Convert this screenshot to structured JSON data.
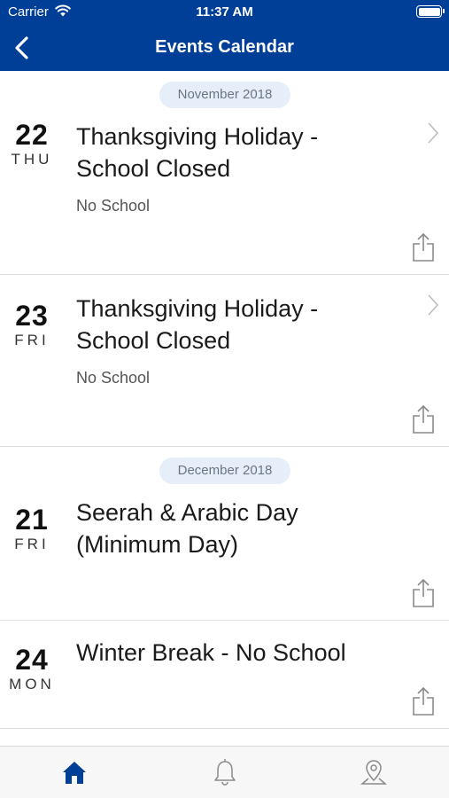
{
  "status_bar": {
    "carrier": "Carrier",
    "time": "11:37 AM"
  },
  "nav": {
    "title": "Events Calendar",
    "back_icon": "chevron-left-icon"
  },
  "months": [
    {
      "label": "November 2018"
    },
    {
      "label": "December 2018"
    }
  ],
  "events": [
    {
      "day": "22",
      "weekday": "THU",
      "title_line1": "Thanksgiving Holiday -",
      "title_line2": "School Closed",
      "subtitle": "No School",
      "has_detail": true
    },
    {
      "day": "23",
      "weekday": "FRI",
      "title_line1": "Thanksgiving Holiday -",
      "title_line2": "School Closed",
      "subtitle": "No School",
      "has_detail": true
    },
    {
      "day": "21",
      "weekday": "FRI",
      "title_line1": "Seerah & Arabic Day",
      "title_line2": "(Minimum Day)",
      "subtitle": "",
      "has_detail": false
    },
    {
      "day": "24",
      "weekday": "MON",
      "title_line1": "Winter Break - No School",
      "title_line2": "",
      "subtitle": "",
      "has_detail": false
    }
  ],
  "tab_bar": {
    "tabs": [
      {
        "icon": "home-icon",
        "active": true
      },
      {
        "icon": "bell-icon",
        "active": false
      },
      {
        "icon": "map-pin-icon",
        "active": false
      }
    ]
  },
  "colors": {
    "brand": "#003f98",
    "pill_bg": "#e6eef9",
    "inactive_icon": "#8a8a8a"
  }
}
